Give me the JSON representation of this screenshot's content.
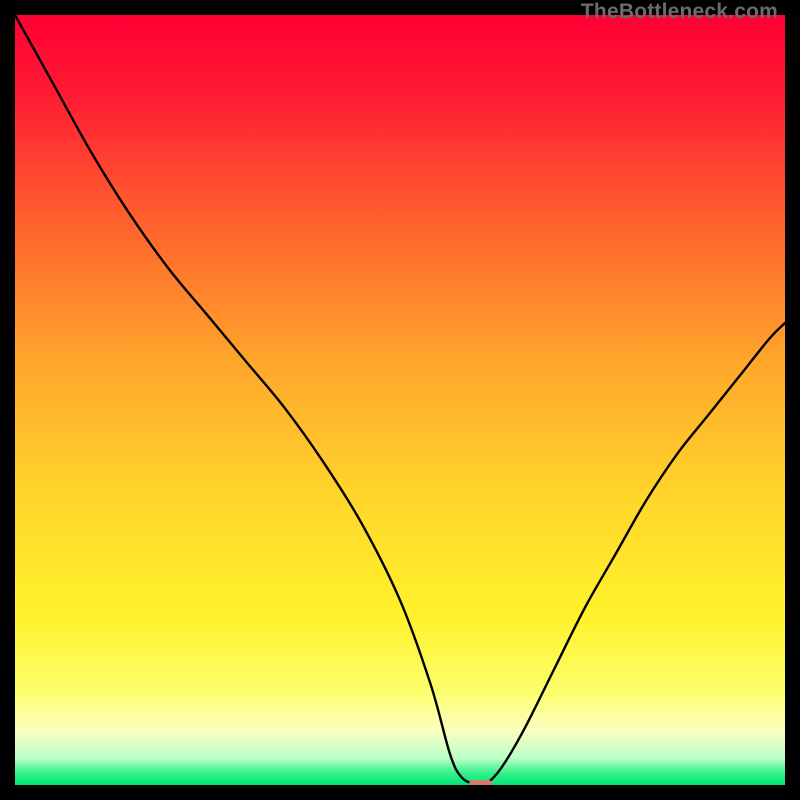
{
  "watermark": "TheBottleneck.com",
  "chart_data": {
    "type": "line",
    "title": "",
    "xlabel": "",
    "ylabel": "",
    "xlim": [
      0,
      100
    ],
    "ylim": [
      0,
      100
    ],
    "gradient_stops": [
      {
        "offset": 0.0,
        "color": "#ff0033"
      },
      {
        "offset": 0.1,
        "color": "#ff1a33"
      },
      {
        "offset": 0.25,
        "color": "#ff5a2e"
      },
      {
        "offset": 0.45,
        "color": "#ffa62b"
      },
      {
        "offset": 0.62,
        "color": "#ffd42b"
      },
      {
        "offset": 0.78,
        "color": "#fff22b"
      },
      {
        "offset": 0.88,
        "color": "#fcff6e"
      },
      {
        "offset": 0.93,
        "color": "#fbffc0"
      },
      {
        "offset": 0.965,
        "color": "#bbffc8"
      },
      {
        "offset": 0.985,
        "color": "#33f089"
      },
      {
        "offset": 1.0,
        "color": "#00e676"
      }
    ],
    "series": [
      {
        "name": "bottleneck-curve",
        "color": "#000000",
        "x": [
          0,
          5,
          10,
          15,
          20,
          25,
          30,
          35,
          40,
          45,
          50,
          54,
          56.5,
          58,
          60,
          61,
          63,
          66,
          70,
          74,
          78,
          82,
          86,
          90,
          94,
          98,
          100
        ],
        "y": [
          100,
          91,
          82,
          74,
          67,
          61,
          55,
          49,
          42,
          34,
          24,
          13,
          4,
          1,
          0,
          0,
          2,
          7,
          15,
          23,
          30,
          37,
          43,
          48,
          53,
          58,
          60
        ]
      }
    ],
    "marker": {
      "x": 60.5,
      "y": 0,
      "width": 3.2,
      "height": 1.3,
      "color": "#d47a71"
    }
  }
}
